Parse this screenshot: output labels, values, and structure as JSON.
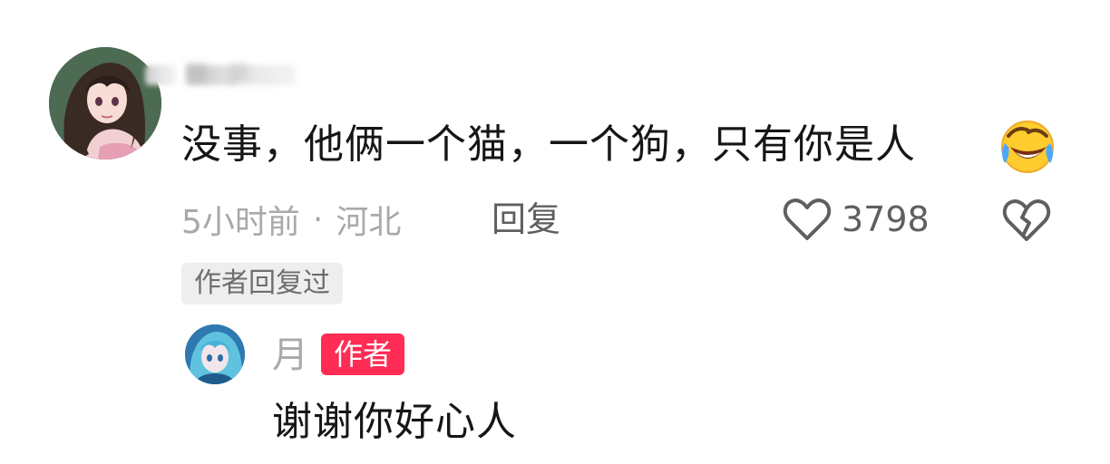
{
  "comment": {
    "username_blurred": "陳 屰",
    "text": "没事，他俩一个猫，一个狗，只有你是人",
    "emoji": "rolling-on-floor-laughing-emoji",
    "time": "5小时前",
    "separator": "·",
    "location": "河北",
    "reply_label": "回复",
    "like_count": "3798",
    "author_replied_badge": "作者回复过"
  },
  "reply": {
    "username": "月",
    "author_tag": "作者",
    "text": "谢谢你好心人"
  },
  "colors": {
    "author_tag_bg": "#ff2c55",
    "primary_text": "#161616",
    "secondary_text": "#a9a9a9",
    "badge_bg": "#eeeeee"
  },
  "icons": {
    "like": "heart-outline-icon",
    "dislike": "broken-heart-outline-icon"
  }
}
